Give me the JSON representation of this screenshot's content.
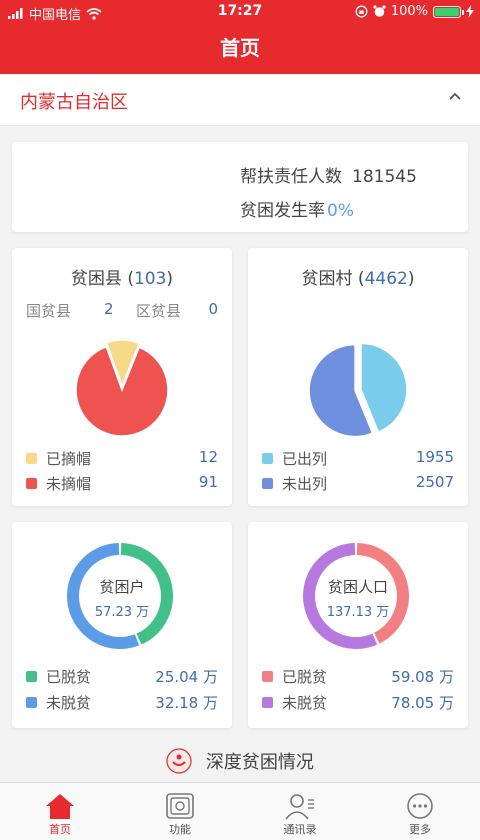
{
  "status": {
    "carrier": "中国电信",
    "time": "17:27",
    "battery": "100%"
  },
  "nav": {
    "title": "首页"
  },
  "region": {
    "name": "内蒙古自治区"
  },
  "summary": {
    "label1": "帮扶责任人数",
    "value1": "181545",
    "label2": "贫困发生率",
    "value2": "0%"
  },
  "county": {
    "title": "贫困县",
    "count": "103",
    "national_label": "国贫县",
    "national_value": "2",
    "district_label": "区贫县",
    "district_value": "0",
    "legend": [
      {
        "label": "已摘帽",
        "value": "12",
        "color": "#f8d98a"
      },
      {
        "label": "未摘帽",
        "value": "91",
        "color": "#ef5350"
      }
    ]
  },
  "village": {
    "title": "贫困村",
    "count": "4462",
    "legend": [
      {
        "label": "已出列",
        "value": "1955",
        "color": "#79cdeb"
      },
      {
        "label": "未出列",
        "value": "2507",
        "color": "#6f8fdf"
      }
    ]
  },
  "household": {
    "title": "贫困户",
    "total": "57.23 万",
    "legend": [
      {
        "label": "已脱贫",
        "value": "25.04 万",
        "color": "#41c08a"
      },
      {
        "label": "未脱贫",
        "value": "32.18 万",
        "color": "#5b9be8"
      }
    ]
  },
  "population": {
    "title": "贫困人口",
    "total": "137.13 万",
    "legend": [
      {
        "label": "已脱贫",
        "value": "59.08 万",
        "color": "#f37f83"
      },
      {
        "label": "未脱贫",
        "value": "78.05 万",
        "color": "#b779e0"
      }
    ]
  },
  "deep": {
    "label": "深度贫困情况"
  },
  "tabs": [
    {
      "label": "首页",
      "icon": "home-icon"
    },
    {
      "label": "功能",
      "icon": "function-icon"
    },
    {
      "label": "通讯录",
      "icon": "contacts-icon"
    },
    {
      "label": "更多",
      "icon": "more-icon"
    }
  ],
  "chart_data": [
    {
      "type": "pie",
      "title": "贫困县 (103)",
      "categories": [
        "已摘帽",
        "未摘帽"
      ],
      "values": [
        12,
        91
      ]
    },
    {
      "type": "pie",
      "title": "贫困村 (4462)",
      "categories": [
        "已出列",
        "未出列"
      ],
      "values": [
        1955,
        2507
      ]
    },
    {
      "type": "pie",
      "title": "贫困户",
      "categories": [
        "已脱贫",
        "未脱贫"
      ],
      "values": [
        25.04,
        32.18
      ]
    },
    {
      "type": "pie",
      "title": "贫困人口",
      "categories": [
        "已脱贫",
        "未脱贫"
      ],
      "values": [
        59.08,
        78.05
      ]
    }
  ]
}
